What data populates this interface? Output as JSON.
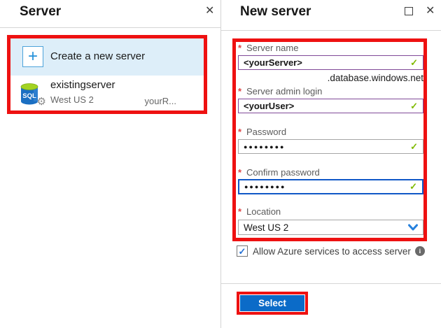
{
  "colors": {
    "annotation_red": "#ee1111",
    "primary_button_blue": "#0b6bc8",
    "valid_check_green": "#7fba00",
    "edited_input_purple": "#804998",
    "focused_input_blue": "#1058c7",
    "selected_row_background": "#ddeef9",
    "accent_blue": "#2390d9"
  },
  "left_panel": {
    "title": "Server",
    "close_icon": "✕",
    "create_item": {
      "icon": "+",
      "label": "Create a new server"
    },
    "server_item": {
      "name": "existingserver",
      "location": "West US 2",
      "resource_group": "yourR...",
      "icon_label": "SQL",
      "gear_icon": "⚙"
    }
  },
  "right_panel": {
    "title": "New server",
    "close_icon": "✕",
    "required_marker": "*",
    "valid_marker": "✓",
    "fields": [
      {
        "label": "Server name",
        "value": "<yourServer>",
        "suffix": ".database.windows.net"
      },
      {
        "label": "Server admin login",
        "value": "<yourUser>"
      },
      {
        "label": "Password",
        "value": "●●●●●●●●"
      },
      {
        "label": "Confirm password",
        "value": "●●●●●●●●"
      },
      {
        "label": "Location",
        "value": "West US 2"
      }
    ],
    "checkbox": {
      "check_icon": "✓",
      "label": "Allow Azure services to access server",
      "info_icon": "i",
      "checked": true
    },
    "select_button_label": "Select"
  }
}
